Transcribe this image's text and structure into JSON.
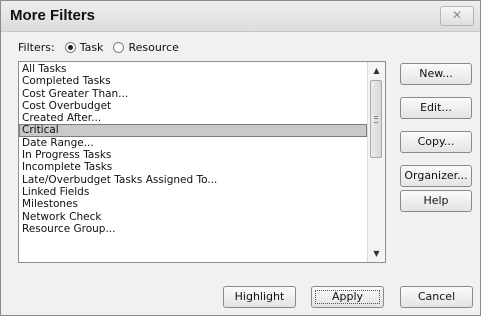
{
  "window": {
    "title": "More Filters",
    "close_icon": "close-icon"
  },
  "filters": {
    "label": "Filters:",
    "options": [
      {
        "label": "Task",
        "checked": true
      },
      {
        "label": "Resource",
        "checked": false
      }
    ]
  },
  "list": {
    "items": [
      "All Tasks",
      "Completed Tasks",
      "Cost Greater Than...",
      "Cost Overbudget",
      "Created After...",
      "Critical",
      "Date Range...",
      "In Progress Tasks",
      "Incomplete Tasks",
      "Late/Overbudget Tasks Assigned To...",
      "Linked Fields",
      "Milestones",
      "Network Check",
      "Resource Group..."
    ],
    "selected": "Critical",
    "scroll_up_icon": "▲",
    "scroll_down_icon": "▼"
  },
  "side_buttons": {
    "new": "New...",
    "edit": "Edit...",
    "copy": "Copy...",
    "organizer": "Organizer...",
    "help": "Help"
  },
  "bottom_buttons": {
    "highlight": "Highlight",
    "apply": "Apply",
    "cancel": "Cancel"
  }
}
